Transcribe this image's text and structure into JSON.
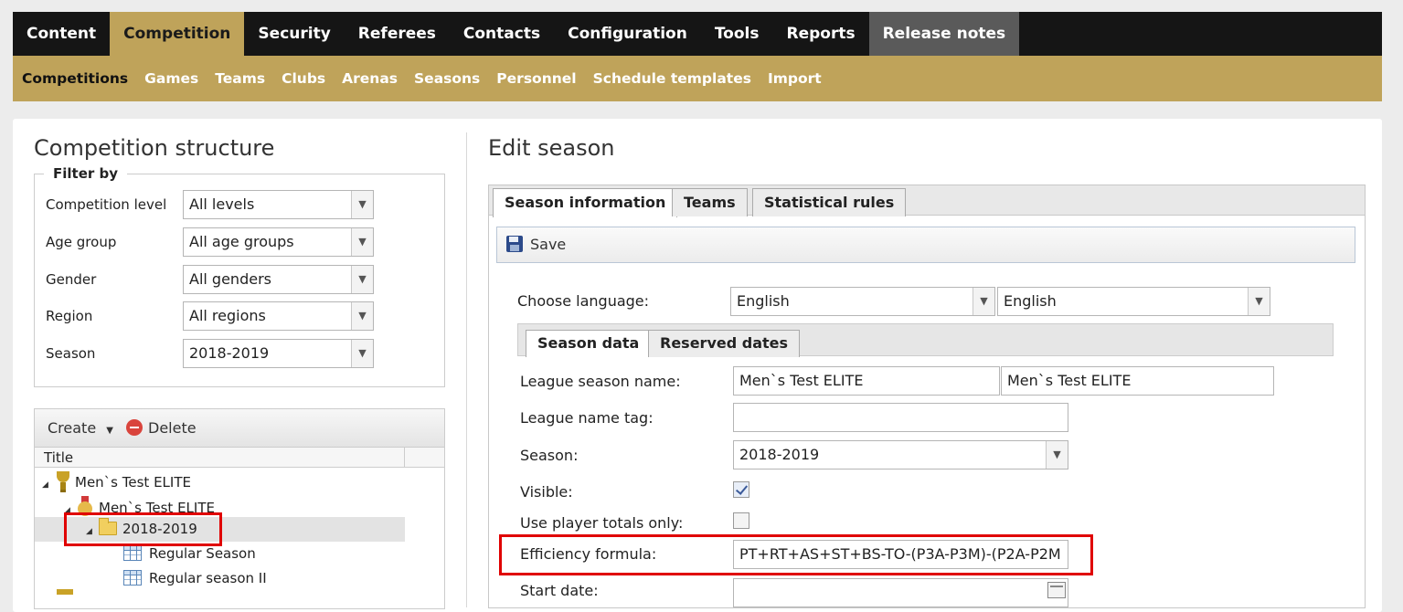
{
  "topnav": {
    "tabs": [
      "Content",
      "Competition",
      "Security",
      "Referees",
      "Contacts",
      "Configuration",
      "Tools",
      "Reports",
      "Release notes"
    ]
  },
  "subnav": {
    "items": [
      "Competitions",
      "Games",
      "Teams",
      "Clubs",
      "Arenas",
      "Seasons",
      "Personnel",
      "Schedule templates",
      "Import"
    ]
  },
  "left": {
    "title": "Competition structure",
    "filter": {
      "legend": "Filter by",
      "level_label": "Competition level",
      "level_value": "All levels",
      "age_label": "Age group",
      "age_value": "All age groups",
      "gender_label": "Gender",
      "gender_value": "All genders",
      "region_label": "Region",
      "region_value": "All regions",
      "season_label": "Season",
      "season_value": "2018-2019"
    },
    "tree": {
      "create_label": "Create",
      "delete_label": "Delete",
      "column_title": "Title",
      "nodes": [
        "Men`s Test ELITE",
        "Men`s Test ELITE",
        "2018-2019",
        "Regular Season",
        "Regular season II"
      ]
    }
  },
  "right": {
    "title": "Edit season",
    "tabs": [
      "Season information",
      "Teams",
      "Statistical rules"
    ],
    "save_label": "Save",
    "choose_language_label": "Choose language:",
    "language_1": "English",
    "language_2": "English",
    "inner_tabs": [
      "Season data",
      "Reserved dates"
    ],
    "form": {
      "league_season_name_label": "League season name:",
      "league_season_name_1": "Men`s Test ELITE",
      "league_season_name_2": "Men`s Test ELITE",
      "league_name_tag_label": "League name tag:",
      "league_name_tag_value": "",
      "season_label": "Season:",
      "season_value": "2018-2019",
      "visible_label": "Visible:",
      "visible_checked": true,
      "player_totals_label": "Use player totals only:",
      "player_totals_checked": false,
      "efficiency_label": "Efficiency formula:",
      "efficiency_value": "PT+RT+AS+ST+BS-TO-(P3A-P3M)-(P2A-P2M",
      "start_date_label": "Start date:",
      "start_date_value": ""
    }
  },
  "colors": {
    "nav_bg": "#151515",
    "accent_gold": "#bfa35a",
    "highlight_red": "#e00000"
  }
}
